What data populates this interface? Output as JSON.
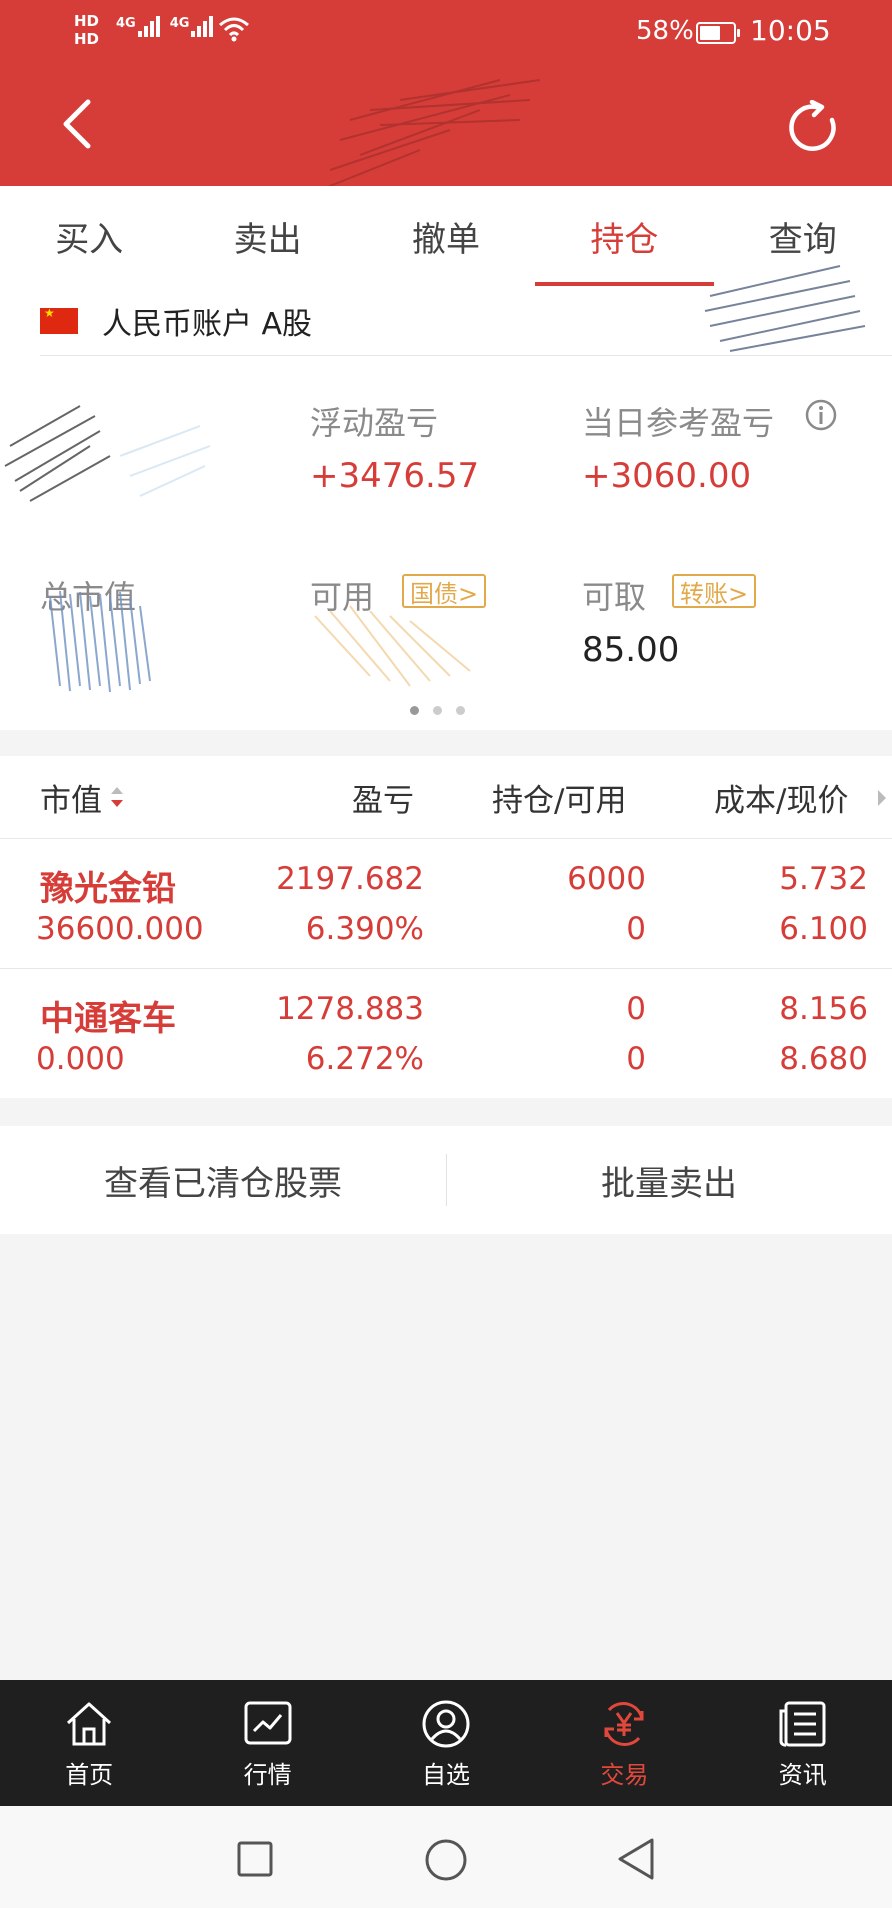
{
  "status_bar": {
    "sim1": "HD",
    "sim2": "HD",
    "net1": "4G",
    "net2": "4G",
    "battery_percent": "58%",
    "time": "10:05"
  },
  "header": {
    "back_icon": "chevron-left-icon",
    "refresh_icon": "refresh-icon"
  },
  "tabs": [
    {
      "label": "买入",
      "active": false
    },
    {
      "label": "卖出",
      "active": false
    },
    {
      "label": "撤单",
      "active": false
    },
    {
      "label": "持仓",
      "active": true
    },
    {
      "label": "查询",
      "active": false
    }
  ],
  "account": {
    "name": "人民币账户 A股",
    "floating_pnl_label": "浮动盈亏",
    "floating_pnl_value": "+3476.57",
    "daily_pnl_label": "当日参考盈亏",
    "daily_pnl_value": "+3060.00",
    "total_market_value_label": "总市值",
    "available_label": "可用",
    "treasury_button": "国债>",
    "withdrawable_label": "可取",
    "withdrawable_value": "85.00",
    "transfer_button": "转账>"
  },
  "holdings": {
    "headers": [
      "市值",
      "盈亏",
      "持仓/可用",
      "成本/现价"
    ],
    "rows": [
      {
        "name": "豫光金铅",
        "market_value": "36600.000",
        "pnl": "2197.682",
        "pnl_pct": "6.390%",
        "position": "6000",
        "available": "0",
        "cost": "5.732",
        "price": "6.100"
      },
      {
        "name": "中通客车",
        "market_value": "0.000",
        "pnl": "1278.883",
        "pnl_pct": "6.272%",
        "position": "0",
        "available": "0",
        "cost": "8.156",
        "price": "8.680"
      }
    ]
  },
  "actions": {
    "view_cleared": "查看已清仓股票",
    "batch_sell": "批量卖出"
  },
  "bottom_nav": [
    {
      "label": "首页",
      "icon": "home-icon",
      "active": false
    },
    {
      "label": "行情",
      "icon": "chart-icon",
      "active": false
    },
    {
      "label": "自选",
      "icon": "favorite-user-icon",
      "active": false
    },
    {
      "label": "交易",
      "icon": "yuan-trade-icon",
      "active": true
    },
    {
      "label": "资讯",
      "icon": "news-icon",
      "active": false
    }
  ],
  "colors": {
    "brand_red": "#d63d38",
    "accent_gold": "#e2a94a",
    "nav_bg": "#1f1f1f"
  }
}
